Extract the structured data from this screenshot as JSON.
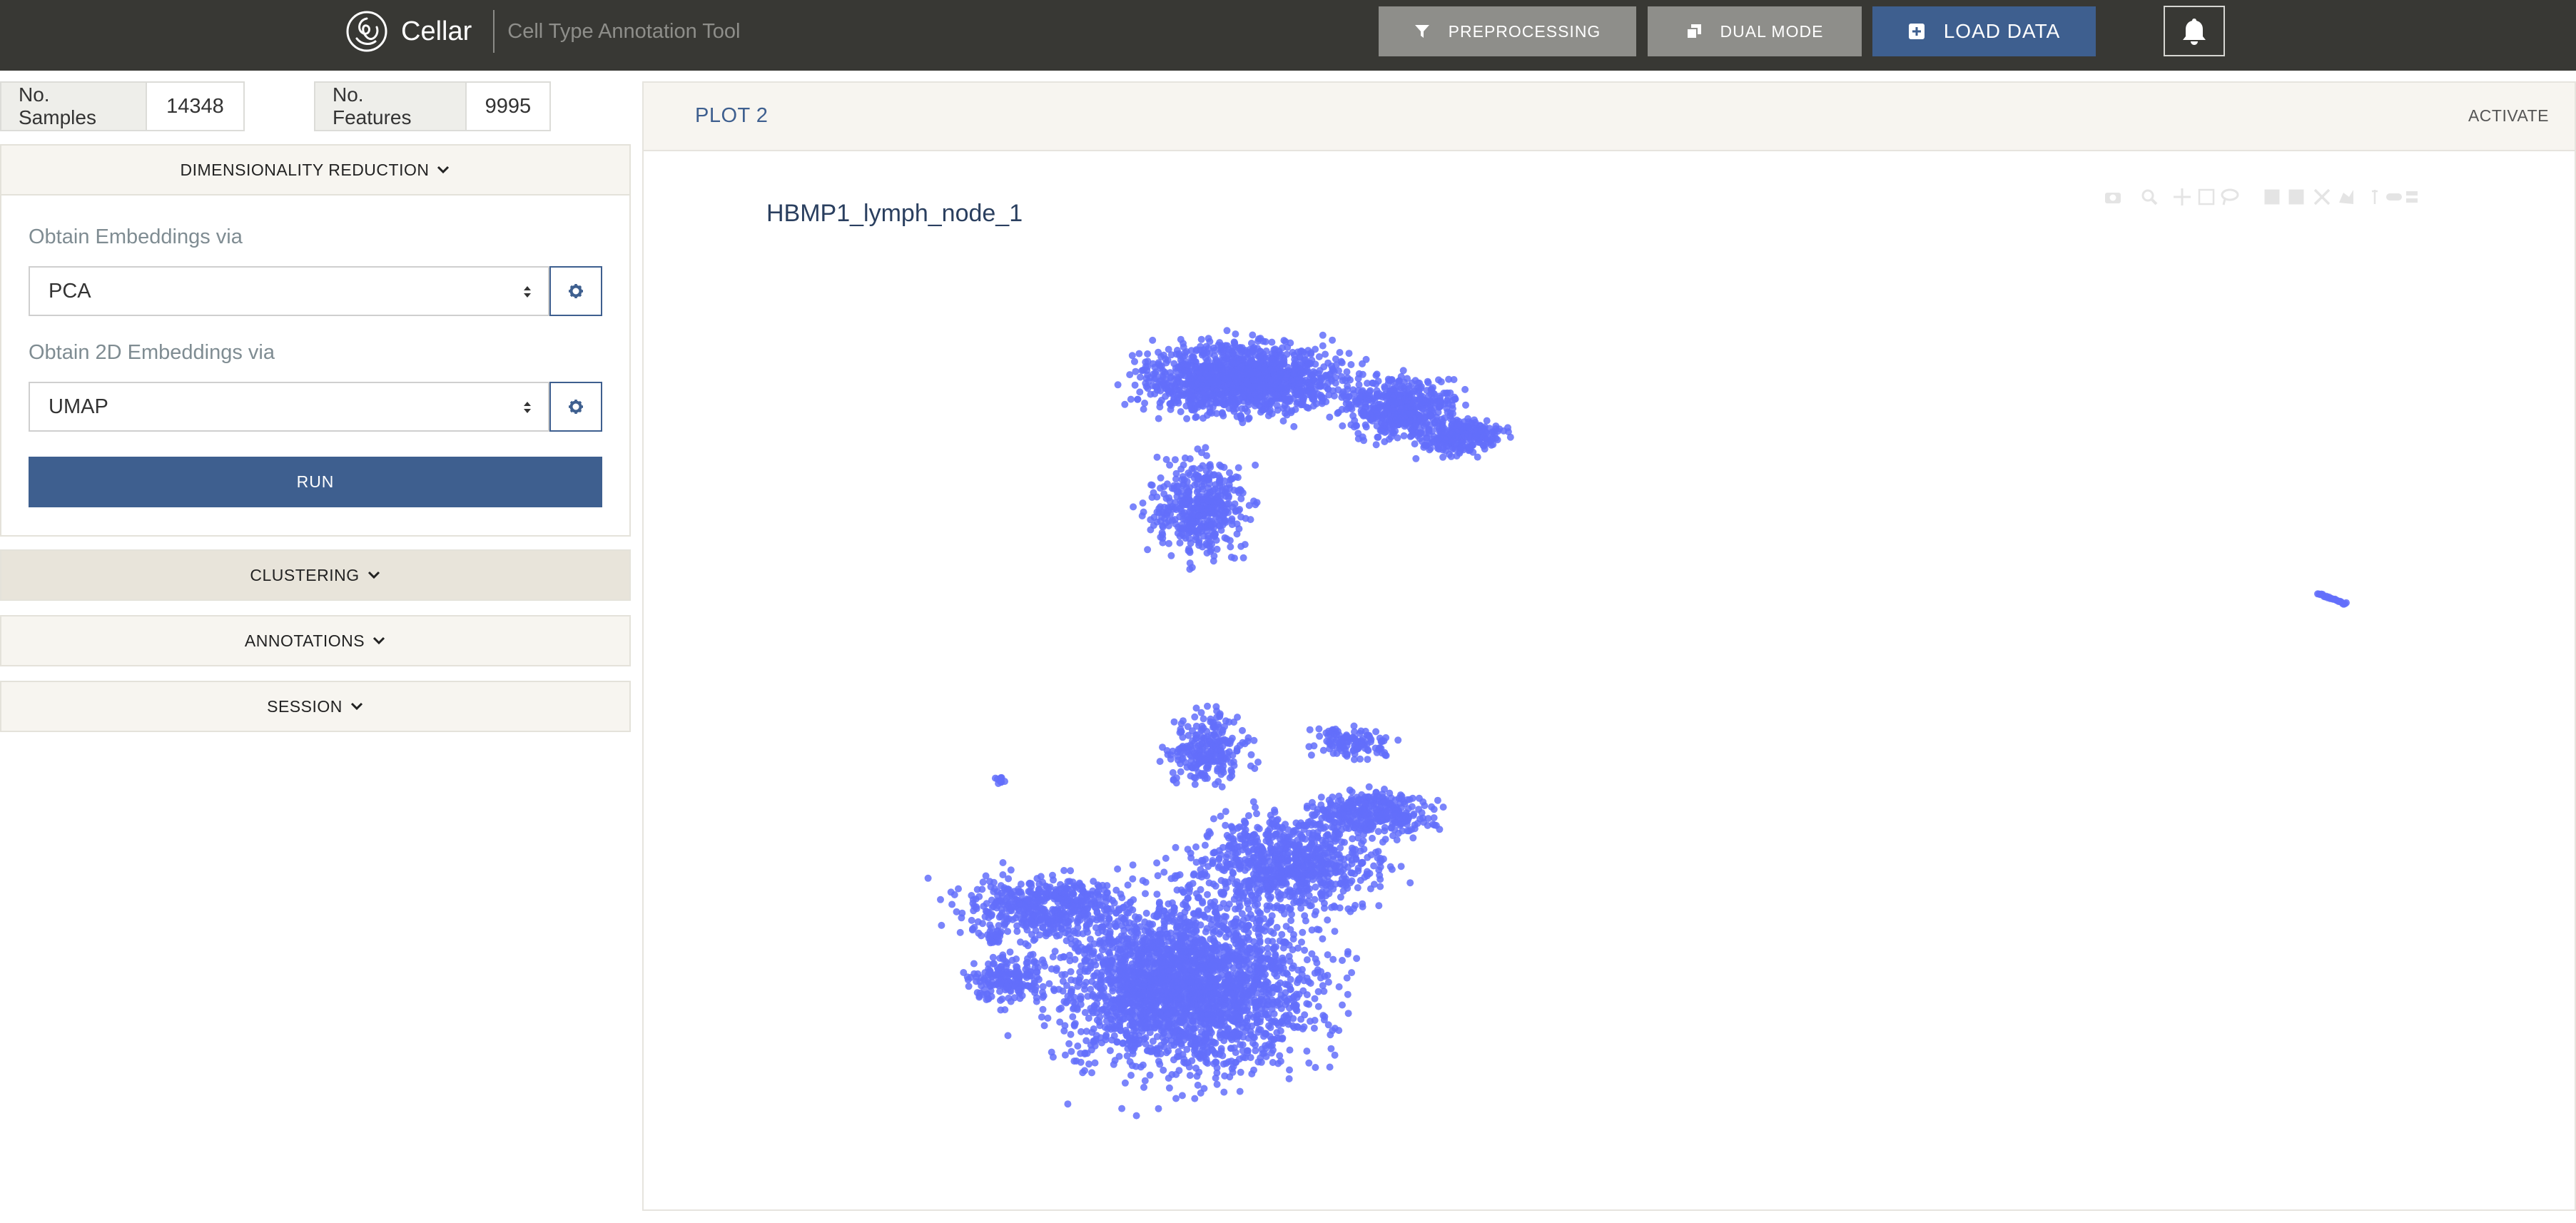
{
  "topbar": {
    "app_name": "Cellar",
    "subtitle": "Cell Type Annotation Tool",
    "buttons": {
      "preprocessing": "PREPROCESSING",
      "dual_mode": "DUAL MODE",
      "load_data": "LOAD DATA"
    },
    "icons": [
      "cellar-logo-icon",
      "filter-icon",
      "copy-icon",
      "plus-square-icon",
      "bell-icon"
    ]
  },
  "stats": {
    "samples_label": "No. Samples",
    "samples_value": "14348",
    "features_label": "No. Features",
    "features_value": "9995"
  },
  "sidebar": {
    "dim_reduction": {
      "title": "DIMENSIONALITY REDUCTION",
      "embeddings_label": "Obtain Embeddings via",
      "embeddings_value": "PCA",
      "embeddings_2d_label": "Obtain 2D Embeddings via",
      "embeddings_2d_value": "UMAP",
      "run_label": "RUN"
    },
    "clustering_title": "CLUSTERING",
    "annotations_title": "ANNOTATIONS",
    "session_title": "SESSION"
  },
  "plot": {
    "panel_title": "PLOT 2",
    "activate_label": "ACTIVATE",
    "title": "HBMP1_lymph_node_1",
    "point_color": "#636efa",
    "modebar_icons": [
      "camera-icon",
      "zoom-icon",
      "pan-icon",
      "box-select-icon",
      "lasso-select-icon",
      "zoom-in-icon",
      "zoom-out-icon",
      "autoscale-icon",
      "reset-axes-icon",
      "spike-lines-icon",
      "hover-closest-icon",
      "hover-compare-icon"
    ]
  },
  "colors": {
    "topbar": "#383834",
    "accent": "#3e5f8f",
    "muted_button": "#8e8e8a",
    "panel_header": "#f7f5f0"
  }
}
